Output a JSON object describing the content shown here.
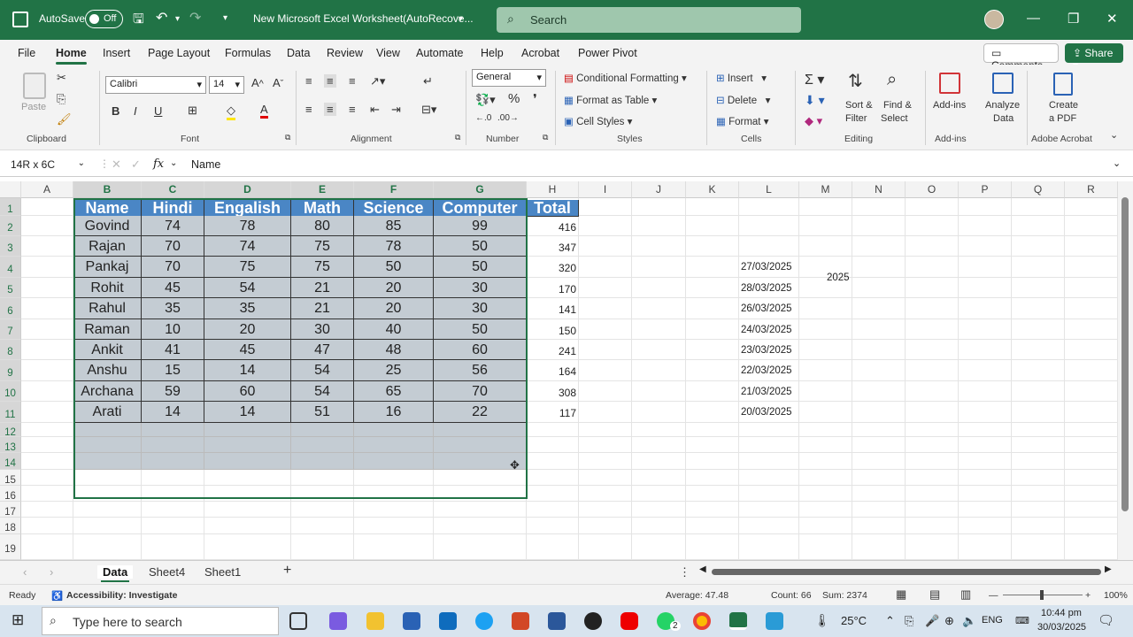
{
  "titlebar": {
    "autosave_label": "AutoSave",
    "autosave_state": "Off",
    "doc_title": "New Microsoft Excel Worksheet(AutoRecove...",
    "search_placeholder": "Search",
    "accent": "#217346"
  },
  "menu": {
    "items": [
      "File",
      "Home",
      "Insert",
      "Page Layout",
      "Formulas",
      "Data",
      "Review",
      "View",
      "Automate",
      "Help",
      "Acrobat",
      "Power Pivot"
    ],
    "active": "Home",
    "comments": "Comments",
    "share": "Share"
  },
  "ribbon": {
    "clipboard": {
      "paste": "Paste",
      "label": "Clipboard"
    },
    "font": {
      "name": "Calibri",
      "size": "14",
      "label": "Font"
    },
    "alignment": {
      "label": "Alignment"
    },
    "number": {
      "format": "General",
      "label": "Number"
    },
    "styles": {
      "conditional": "Conditional Formatting",
      "table": "Format as Table",
      "cell": "Cell Styles",
      "label": "Styles"
    },
    "cells": {
      "insert": "Insert",
      "delete": "Delete",
      "format": "Format",
      "label": "Cells"
    },
    "editing": {
      "sort_1": "Sort &",
      "sort_2": "Filter",
      "find_1": "Find &",
      "find_2": "Select",
      "label": "Editing"
    },
    "addins": {
      "addins": "Add-ins",
      "analyze_1": "Analyze",
      "analyze_2": "Data",
      "label": "Add-ins"
    },
    "acrobat": {
      "create_1": "Create",
      "create_2": "a PDF",
      "label": "Adobe Acrobat"
    }
  },
  "formula_bar": {
    "name_box": "14R x 6C",
    "fx": "fx",
    "value": "Name"
  },
  "columns": [
    "A",
    "B",
    "C",
    "D",
    "E",
    "F",
    "G",
    "H",
    "I",
    "J",
    "K",
    "L",
    "M",
    "N",
    "O",
    "P",
    "Q",
    "R"
  ],
  "rows": [
    "1",
    "2",
    "3",
    "4",
    "5",
    "6",
    "7",
    "8",
    "9",
    "10",
    "11",
    "12",
    "13",
    "14",
    "15",
    "16",
    "17",
    "18",
    "19"
  ],
  "table": {
    "headers": [
      "Name",
      "Hindi",
      "Engalish",
      "Math",
      "Science",
      "Computer"
    ],
    "rows": [
      [
        "Govind",
        "74",
        "78",
        "80",
        "85",
        "99"
      ],
      [
        "Rajan",
        "70",
        "74",
        "75",
        "78",
        "50"
      ],
      [
        "Pankaj",
        "70",
        "75",
        "75",
        "50",
        "50"
      ],
      [
        "Rohit",
        "45",
        "54",
        "21",
        "20",
        "30"
      ],
      [
        "Rahul",
        "35",
        "35",
        "21",
        "20",
        "30"
      ],
      [
        "Raman",
        "10",
        "20",
        "30",
        "40",
        "50"
      ],
      [
        "Ankit",
        "41",
        "45",
        "47",
        "48",
        "60"
      ],
      [
        "Anshu",
        "15",
        "14",
        "54",
        "25",
        "56"
      ],
      [
        "Archana",
        "59",
        "60",
        "54",
        "65",
        "70"
      ],
      [
        "Arati",
        "14",
        "14",
        "51",
        "16",
        "22"
      ]
    ],
    "header_color": "#4a86c5",
    "body_color": "#c4ccd3"
  },
  "total": {
    "header": "Total",
    "values": [
      "416",
      "347",
      "320",
      "170",
      "141",
      "150",
      "241",
      "164",
      "308",
      "117"
    ]
  },
  "dates": [
    "27/03/2025",
    "28/03/2025",
    "26/03/2025",
    "24/03/2025",
    "23/03/2025",
    "22/03/2025",
    "21/03/2025",
    "20/03/2025"
  ],
  "m4": "2025",
  "sheet_tabs": [
    "Data",
    "Sheet4",
    "Sheet1"
  ],
  "active_sheet": "Data",
  "status": {
    "ready": "Ready",
    "accessibility": "Accessibility: Investigate",
    "average": "Average: 47.48",
    "count": "Count: 66",
    "sum": "Sum: 2374",
    "zoom": "100%"
  },
  "taskbar": {
    "search": "Type here to search",
    "temp": "25°C",
    "lang": "ENG",
    "time": "10:44 pm",
    "date": "30/03/2025",
    "whatsapp_badge": "2"
  }
}
